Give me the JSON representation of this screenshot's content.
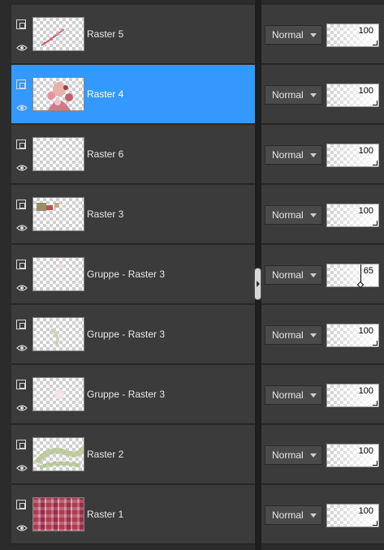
{
  "layers": [
    {
      "name": "Raster 5",
      "blend_mode": "Normal",
      "opacity": "100",
      "selected": false,
      "thumb": "floral-sprig"
    },
    {
      "name": "Raster 4",
      "blend_mode": "Normal",
      "opacity": "100",
      "selected": true,
      "thumb": "portrait-figure"
    },
    {
      "name": "Raster 6",
      "blend_mode": "Normal",
      "opacity": "100",
      "selected": false,
      "thumb": "empty"
    },
    {
      "name": "Raster 3",
      "blend_mode": "Normal",
      "opacity": "100",
      "selected": false,
      "thumb": "small-shapes"
    },
    {
      "name": "Gruppe - Raster 3",
      "blend_mode": "Normal",
      "opacity": "65",
      "selected": false,
      "thumb": "faint"
    },
    {
      "name": "Gruppe - Raster 3",
      "blend_mode": "Normal",
      "opacity": "100",
      "selected": false,
      "thumb": "faint-green"
    },
    {
      "name": "Gruppe - Raster 3",
      "blend_mode": "Normal",
      "opacity": "100",
      "selected": false,
      "thumb": "faint-pink"
    },
    {
      "name": "Raster 2",
      "blend_mode": "Normal",
      "opacity": "100",
      "selected": false,
      "thumb": "green-wash"
    },
    {
      "name": "Raster 1",
      "blend_mode": "Normal",
      "opacity": "100",
      "selected": false,
      "thumb": "pink-plaid"
    }
  ],
  "colors": {
    "panel": "#3b3b3b",
    "selected": "#3399ff",
    "background": "#2b2b2b"
  },
  "icons": {
    "layer_type": "raster-layer-icon",
    "visibility": "eye-icon",
    "dropdown": "chevron-down-icon"
  }
}
